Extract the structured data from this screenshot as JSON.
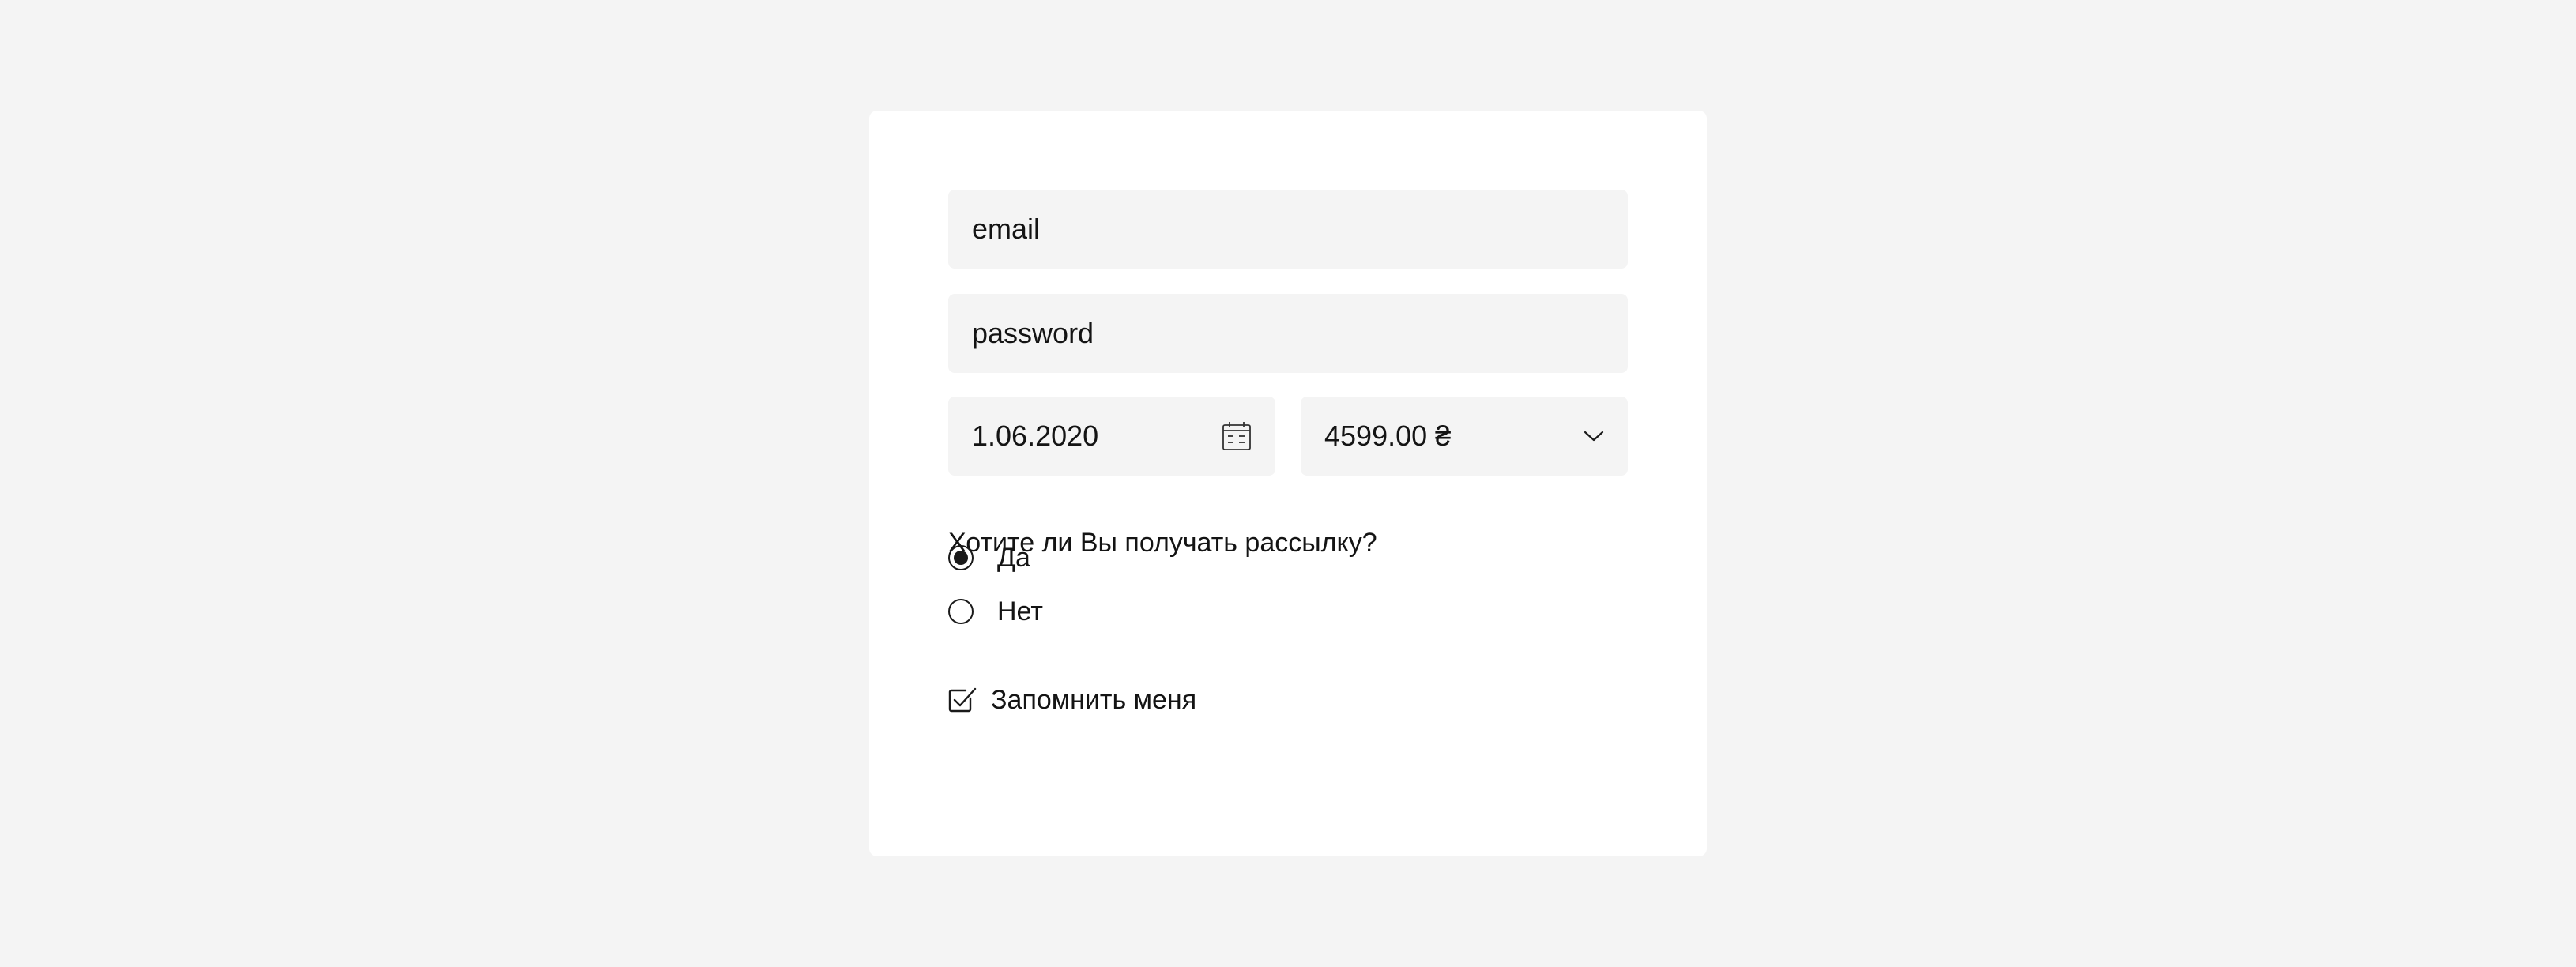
{
  "form": {
    "email": {
      "placeholder": "email"
    },
    "password": {
      "placeholder": "password"
    },
    "date": {
      "value": "1.06.2020",
      "icon": "calendar-icon"
    },
    "amount": {
      "value": "4599.00 ₴",
      "icon": "chevron-down-icon"
    },
    "newsletter": {
      "question": "Хотите ли Вы получать рассылку?",
      "options": [
        {
          "label": "Да",
          "selected": true
        },
        {
          "label": "Нет",
          "selected": false
        }
      ]
    },
    "remember": {
      "label": "Запомнить меня",
      "checked": true
    }
  },
  "colors": {
    "page_background": "#f4f4f4",
    "card_background": "#ffffff",
    "field_background": "#f4f4f4",
    "text": "#141414"
  }
}
